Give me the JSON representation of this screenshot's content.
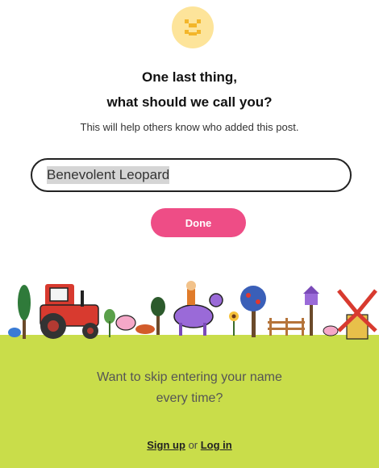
{
  "avatar": {
    "icon": "pixel-face-icon",
    "color": "#fde49a"
  },
  "heading": {
    "line1": "One last thing,",
    "line2": "what should we call you?"
  },
  "subtitle": "This will help others know who added this post.",
  "name_field": {
    "value": "Benevolent Leopard"
  },
  "done_button": {
    "label": "Done",
    "color": "#ee4d86"
  },
  "illustration": {
    "name": "farm-scene-illustration"
  },
  "skip_prompt": {
    "line1": "Want to skip entering your name",
    "line2": "every time?"
  },
  "auth": {
    "signup_label": "Sign up",
    "separator": "or",
    "login_label": "Log in"
  },
  "colors": {
    "bottom_panel": "#c9dd4a"
  }
}
